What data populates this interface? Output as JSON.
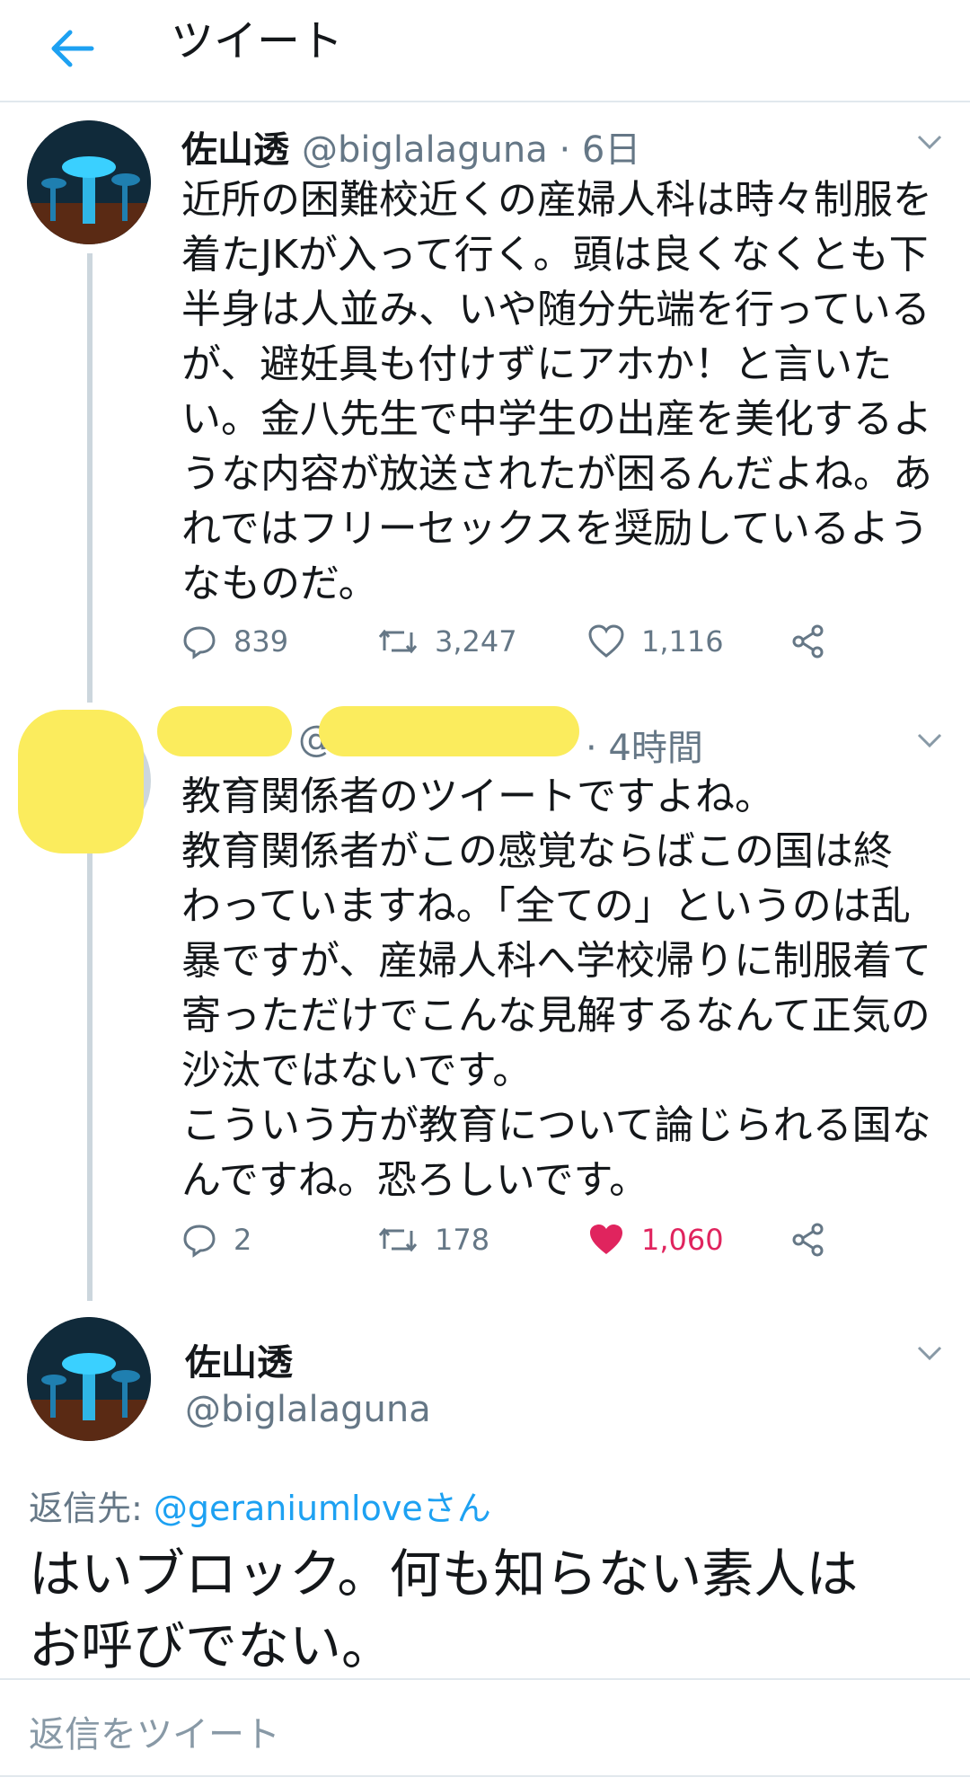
{
  "header": {
    "title": "ツイート",
    "back_icon": "back-arrow-icon"
  },
  "tweets": [
    {
      "name": "佐山透",
      "meta": "@biglalaguna · 6日",
      "text": "近所の困難校近くの産婦人科は時々制服を\n着たJKが入って行く。頭は良くなくとも下\n半身は人並み、いや随分先端を行っている\nが、避妊具も付けずにアホか！と言いた\nい。金八先生で中学生の出産を美化するよ\nうな内容が放送されたが困るんだよね。あ\nれではフリーセックスを奨励しているよう\nなものだ。",
      "replies": "839",
      "retweets": "3,247",
      "likes": "1,116"
    },
    {
      "name": "",
      "meta_at": "@",
      "meta_time": "· 4時間",
      "text": "教育関係者のツイートですよね。\n教育関係者がこの感覚ならばこの国は終\nわっていますね。「全ての」というのは乱\n暴ですが、産婦人科へ学校帰りに制服着て\n寄っただけでこんな見解するなんて正気の\n沙汰ではないです。\nこういう方が教育について論じられる国な\nんですね。恐ろしいです。",
      "replies": "2",
      "retweets": "178",
      "likes": "1,060",
      "liked": true
    }
  ],
  "main_tweet": {
    "name": "佐山透",
    "handle": "@biglalaguna",
    "reply_to_label": "返信先: ",
    "reply_to_mention": "@geraniumloveさん",
    "text": "はいブロック。何も知らない素人は\nお呼びでない。"
  },
  "compose": {
    "placeholder": "返信をツイート"
  },
  "colors": {
    "accent": "#1da1f2",
    "like": "#e0245e",
    "muted": "#657786",
    "redaction": "#fbec5d"
  }
}
